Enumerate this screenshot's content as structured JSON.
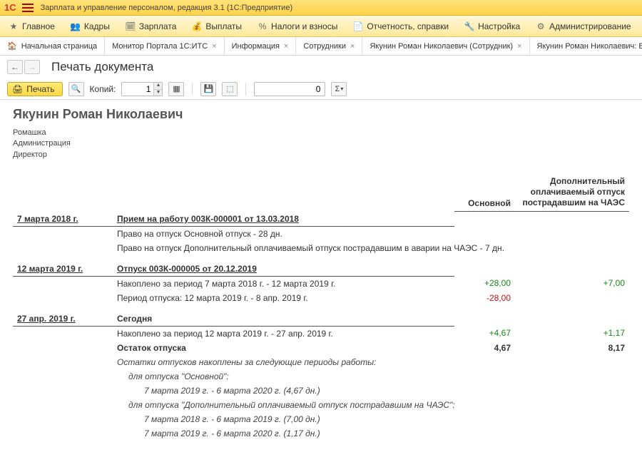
{
  "app": {
    "logo": "1C",
    "title": "Зарплата и управление персоналом, редакция 3.1  (1С:Предприятие)"
  },
  "menubar": [
    {
      "icon": "star",
      "label": "Главное"
    },
    {
      "icon": "people",
      "label": "Кадры"
    },
    {
      "icon": "calc",
      "label": "Зарплата"
    },
    {
      "icon": "money",
      "label": "Выплаты"
    },
    {
      "icon": "percent",
      "label": "Налоги и взносы"
    },
    {
      "icon": "doc",
      "label": "Отчетность, справки"
    },
    {
      "icon": "wrench",
      "label": "Настройка"
    },
    {
      "icon": "gear",
      "label": "Администрирование"
    }
  ],
  "tabs": [
    {
      "label": "Начальная страница",
      "home": true,
      "closable": false
    },
    {
      "label": "Монитор Портала 1С:ИТС",
      "closable": true
    },
    {
      "label": "Информация",
      "closable": true
    },
    {
      "label": "Сотрудники",
      "closable": true
    },
    {
      "label": "Якунин Роман Николаевич (Сотрудник)",
      "closable": true
    },
    {
      "label": "Якунин Роман Николаевич: Все кадровые ",
      "closable": false
    }
  ],
  "nav": {
    "page_title": "Печать документа"
  },
  "toolbar": {
    "print_label": "Печать",
    "copies_label": "Копий:",
    "copies_value": "1",
    "number_value": "0",
    "sigma_label": "Σ"
  },
  "doc": {
    "person": "Якунин Роман Николаевич",
    "org": "Ромашка",
    "dept": "Администрация",
    "position": "Директор",
    "col_main": "Основной",
    "col_extra": "Дополнительный оплачиваемый отпуск пострадавшим на ЧАЭС",
    "sections": [
      {
        "date": "7 марта 2018 г.",
        "title": "Прием на работу 003К-000001 от 13.03.2018",
        "lines": [
          "Право на отпуск Основной отпуск - 28 дн.",
          "Право на отпуск Дополнительный оплачиваемый отпуск пострадавшим в аварии на ЧАЭС - 7 дн."
        ]
      },
      {
        "date": "12 марта 2019 г.",
        "title": "Отпуск 003К-000005 от 20.12.2019",
        "rows": [
          {
            "text": "Накоплено за период 7 марта 2018 г. - 12 марта 2019 г.",
            "v1": "+28,00",
            "v1cls": "pos",
            "v2": "+7,00",
            "v2cls": "pos"
          },
          {
            "text": "Период отпуска: 12 марта 2019 г. - 8 апр. 2019 г.",
            "v1": "-28,00",
            "v1cls": "neg",
            "v2": ""
          }
        ]
      },
      {
        "date": "27 апр. 2019 г.",
        "title_plain": "Сегодня",
        "rows": [
          {
            "text": "Накоплено за период 12 марта 2019 г. - 27 апр. 2019 г.",
            "v1": "+4,67",
            "v1cls": "pos",
            "v2": "+1,17",
            "v2cls": "pos"
          },
          {
            "text": "Остаток отпуска",
            "bold": true,
            "v1": "4,67",
            "v1cls": "bold",
            "v2": "8,17",
            "v2cls": "bold"
          }
        ],
        "notes": [
          {
            "text": "Остатки отпусков накоплены за следующие периоды работы:",
            "indent": 0
          },
          {
            "text": "для отпуска \"Основной\":",
            "indent": 1
          },
          {
            "text": "7 марта 2019 г. - 6 марта 2020 г. (4,67 дн.)",
            "indent": 2
          },
          {
            "text": "для отпуска \"Дополнительный оплачиваемый отпуск пострадавшим на ЧАЭС\":",
            "indent": 1
          },
          {
            "text": "7 марта 2018 г. - 6 марта 2019 г. (7,00 дн.)",
            "indent": 2
          },
          {
            "text": "7 марта 2019 г. - 6 марта 2020 г. (1,17 дн.)",
            "indent": 2
          }
        ]
      }
    ]
  }
}
